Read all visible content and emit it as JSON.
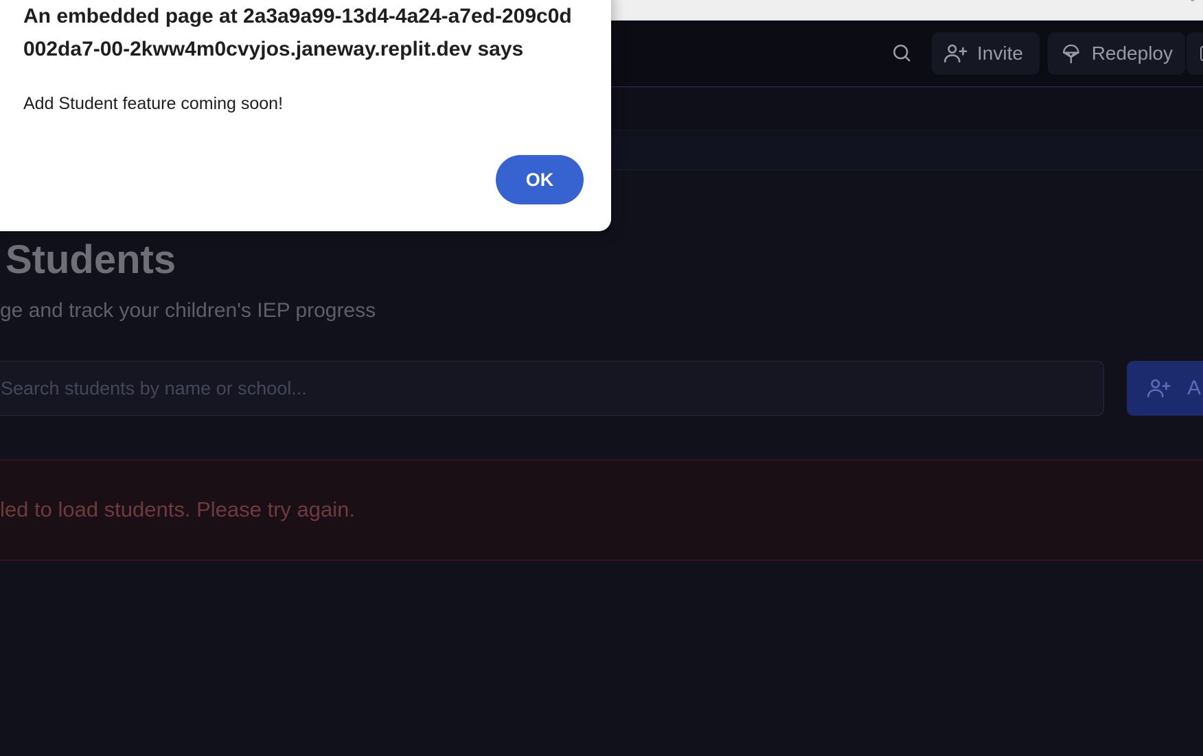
{
  "dialog": {
    "title": "An embedded page at 2a3a9a99-13d4-4a24-a7ed-209c0d002da7-00-2kww4m0cvyjos.janeway.replit.dev says",
    "message": "Add Student feature coming soon!",
    "ok_label": "OK"
  },
  "header": {
    "invite_label": "Invite",
    "redeploy_label": "Redeploy"
  },
  "page": {
    "title": "Students",
    "subtitle": "ge and track your children's IEP progress"
  },
  "search": {
    "placeholder": "Search students by name or school..."
  },
  "add_button": {
    "label": "A"
  },
  "error": {
    "message": "led to load students. Please try again."
  },
  "colors": {
    "background": "#10111b",
    "accent": "#3763d0",
    "error": "#6d3a3d"
  }
}
